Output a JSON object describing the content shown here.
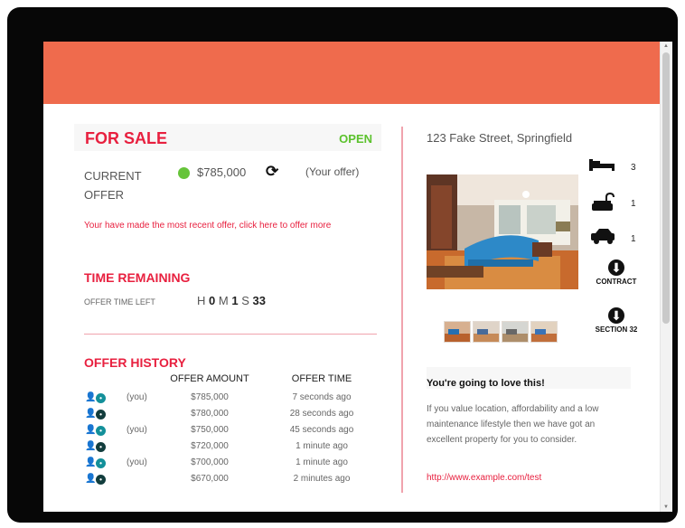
{
  "listing": {
    "status": "FOR SALE",
    "state": "OPEN",
    "current_offer_label": "CURRENT OFFER",
    "current_offer_price": "$785,000",
    "refresh_icon": "refresh-icon",
    "your_offer": "(Your offer)",
    "notice": "Your have made the most recent offer, click here to offer more",
    "time_remaining_title": "TIME REMAINING",
    "offer_time_left_label": "OFFER TIME LEFT",
    "time_h_label": "H",
    "time_h": "0",
    "time_m_label": "M",
    "time_m": "1",
    "time_s_label": "S",
    "time_s": "33",
    "offer_history_title": "OFFER HISTORY",
    "column_offer_amount": "OFFER AMOUNT",
    "column_offer_time": "OFFER TIME",
    "history": [
      {
        "you": "(you)",
        "amount": "$785,000",
        "time": "7 seconds ago",
        "avatar_tone": "teal"
      },
      {
        "you": "",
        "amount": "$780,000",
        "time": "28 seconds ago",
        "avatar_tone": "dark"
      },
      {
        "you": "(you)",
        "amount": "$750,000",
        "time": "45 seconds ago",
        "avatar_tone": "teal"
      },
      {
        "you": "",
        "amount": "$720,000",
        "time": "1 minute ago",
        "avatar_tone": "dark"
      },
      {
        "you": "(you)",
        "amount": "$700,000",
        "time": "1 minute ago",
        "avatar_tone": "teal"
      },
      {
        "you": "",
        "amount": "$670,000",
        "time": "2 minutes ago",
        "avatar_tone": "dark"
      }
    ]
  },
  "property": {
    "address": "123 Fake Street, Springfield",
    "bedrooms": "3",
    "bathrooms": "1",
    "parking": "1",
    "contract_label": "CONTRACT",
    "section_label": "SECTION 32",
    "heading": "You're going to love this!",
    "description": "If you value location, affordability and a low maintenance lifestyle then we have got an excellent property for you to consider.",
    "link": "http://www.example.com/test"
  },
  "theme": {
    "banner_color": "#ef6b4d",
    "accent_red": "#e8203f",
    "open_green": "#5cc22d",
    "avatar_teal": "#13909a",
    "avatar_dark": "#123d3d"
  },
  "icons": [
    "refresh-icon",
    "bed-icon",
    "bath-icon",
    "car-icon",
    "download-icon",
    "user-icon"
  ]
}
